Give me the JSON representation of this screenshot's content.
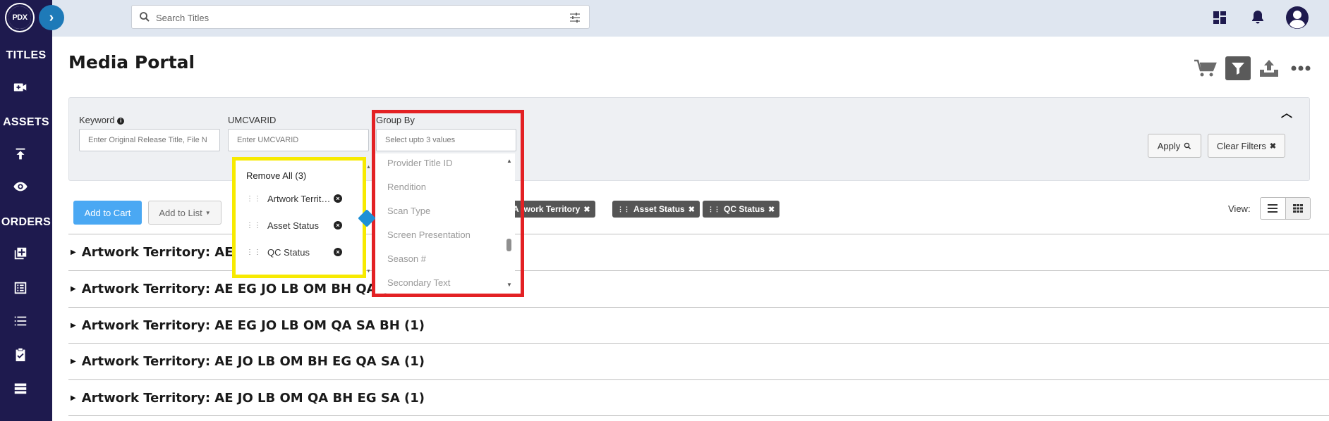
{
  "sidebar": {
    "logo_text": "PDX",
    "headings": {
      "titles": "TITLES",
      "assets": "ASSETS",
      "orders": "ORDERS"
    },
    "icons": [
      "video-plus-icon",
      "upload-icon",
      "eye-icon",
      "add-box-icon",
      "list-alt-icon",
      "list-numbered-icon",
      "clipboard-check-icon",
      "table-rows-icon"
    ]
  },
  "topbar": {
    "search_placeholder": "Search Titles"
  },
  "page": {
    "title": "Media Portal"
  },
  "filters": {
    "keyword_label": "Keyword",
    "keyword_placeholder": "Enter Original Release Title, File N",
    "umcvarid_label": "UMCVARID",
    "umcvarid_placeholder": "Enter UMCVARID",
    "groupby_label": "Group By",
    "groupby_placeholder": "Select upto 3 values",
    "apply_label": "Apply",
    "clear_label": "Clear Filters"
  },
  "groupby_options": [
    "Provider Title ID",
    "Rendition",
    "Scan Type",
    "Screen Presentation",
    "Season #",
    "Secondary Text"
  ],
  "selected_values": {
    "remove_all": "Remove All (3)",
    "items": [
      "Artwork Territory",
      "Asset Status",
      "QC Status"
    ]
  },
  "toolbar": {
    "add_to_cart": "Add to Cart",
    "add_to_list": "Add to List",
    "chips": [
      "A  twork Territory",
      "Asset Status",
      "QC Status"
    ],
    "view_label": "View:"
  },
  "groups": [
    "Artwork Territory: AE E",
    "Artwork Territory: AE EG JO LB OM BH QA S",
    "Artwork Territory: AE EG JO LB OM QA SA BH (1)",
    "Artwork Territory: AE JO LB OM BH EG QA SA (1)",
    "Artwork Territory: AE JO LB OM QA BH EG SA (1)"
  ],
  "colors": {
    "sidebar_bg": "#1e1a4e",
    "topbar_bg": "#dfe6f0",
    "accent_blue": "#4aa8f3",
    "highlight_yellow": "#f7ea00",
    "highlight_red": "#e32124",
    "chip_bg": "#555555"
  }
}
